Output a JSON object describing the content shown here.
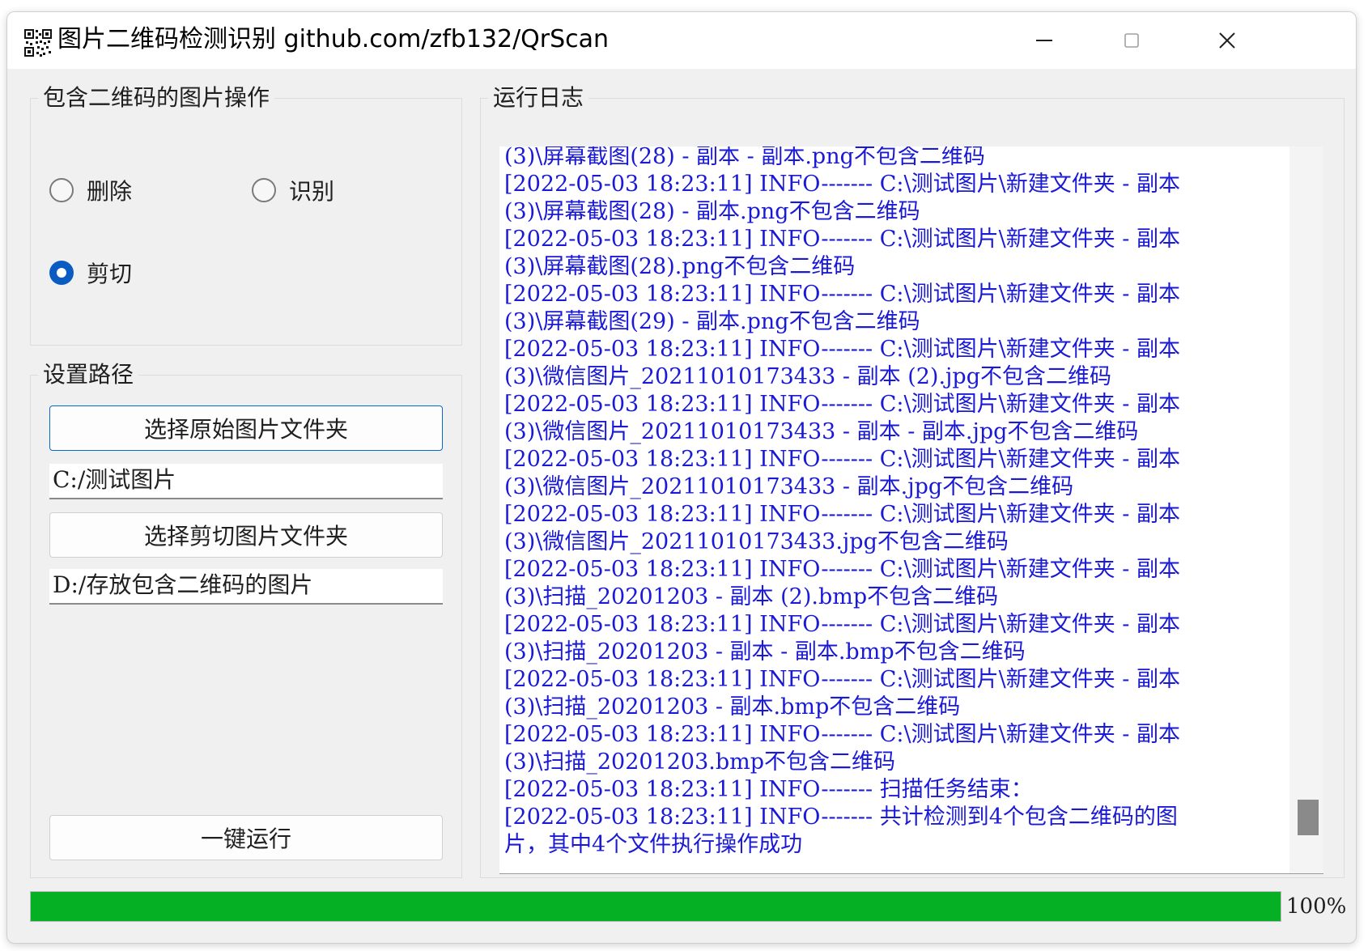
{
  "window": {
    "title": "图片二维码检测识别 github.com/zfb132/QrScan",
    "icon": "qr-code-icon",
    "controls": [
      "minimize-icon",
      "maximize-icon",
      "close-icon"
    ]
  },
  "operations": {
    "title": "包含二维码的图片操作",
    "options": [
      {
        "label": "删除",
        "checked": false
      },
      {
        "label": "识别",
        "checked": false
      },
      {
        "label": "剪切",
        "checked": true
      }
    ]
  },
  "paths": {
    "title": "设置路径",
    "select_source_label": "选择原始图片文件夹",
    "source_path": "C:/测试图片",
    "select_cut_label": "选择剪切图片文件夹",
    "cut_path": "D:/存放包含二维码的图片",
    "run_label": "一键运行"
  },
  "log": {
    "title": "运行日志",
    "lines": [
      "(3)\\屏幕截图(28) - 副本 - 副本.png不包含二维码",
      "[2022-05-03 18:23:11] INFO------- C:\\测试图片\\新建文件夹 - 副本",
      "(3)\\屏幕截图(28) - 副本.png不包含二维码",
      "[2022-05-03 18:23:11] INFO------- C:\\测试图片\\新建文件夹 - 副本",
      "(3)\\屏幕截图(28).png不包含二维码",
      "[2022-05-03 18:23:11] INFO------- C:\\测试图片\\新建文件夹 - 副本",
      "(3)\\屏幕截图(29) - 副本.png不包含二维码",
      "[2022-05-03 18:23:11] INFO------- C:\\测试图片\\新建文件夹 - 副本",
      "(3)\\微信图片_20211010173433 - 副本 (2).jpg不包含二维码",
      "[2022-05-03 18:23:11] INFO------- C:\\测试图片\\新建文件夹 - 副本",
      "(3)\\微信图片_20211010173433 - 副本 - 副本.jpg不包含二维码",
      "[2022-05-03 18:23:11] INFO------- C:\\测试图片\\新建文件夹 - 副本",
      "(3)\\微信图片_20211010173433 - 副本.jpg不包含二维码",
      "[2022-05-03 18:23:11] INFO------- C:\\测试图片\\新建文件夹 - 副本",
      "(3)\\微信图片_20211010173433.jpg不包含二维码",
      "[2022-05-03 18:23:11] INFO------- C:\\测试图片\\新建文件夹 - 副本",
      "(3)\\扫描_20201203 - 副本 (2).bmp不包含二维码",
      "[2022-05-03 18:23:11] INFO------- C:\\测试图片\\新建文件夹 - 副本",
      "(3)\\扫描_20201203 - 副本 - 副本.bmp不包含二维码",
      "[2022-05-03 18:23:11] INFO------- C:\\测试图片\\新建文件夹 - 副本",
      "(3)\\扫描_20201203 - 副本.bmp不包含二维码",
      "[2022-05-03 18:23:11] INFO------- C:\\测试图片\\新建文件夹 - 副本",
      "(3)\\扫描_20201203.bmp不包含二维码",
      "[2022-05-03 18:23:11] INFO------- 扫描任务结束：",
      "[2022-05-03 18:23:11] INFO------- 共计检测到4个包含二维码的图",
      "片，其中4个文件执行操作成功"
    ]
  },
  "progress": {
    "value": 100,
    "text": "100%",
    "color": "#06b025"
  }
}
